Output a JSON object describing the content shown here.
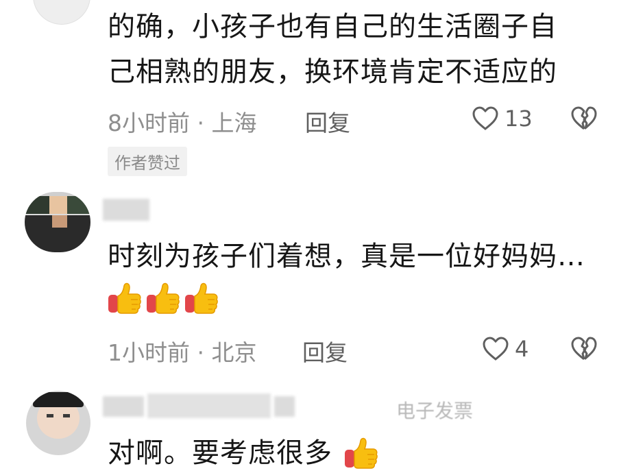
{
  "comments": [
    {
      "text_line1": "的确，小孩子也有自己的生活圈子自",
      "text_line2": "己相熟的朋友，换环境肯定不适应的",
      "meta": "8小时前 · 上海",
      "reply_label": "回复",
      "likes": "13",
      "badge": "作者赞过"
    },
    {
      "text": "时刻为孩子们着想，真是一位好妈妈…",
      "emoji": [
        "thumbs-up",
        "thumbs-up",
        "thumbs-up"
      ],
      "meta": "1小时前 · 北京",
      "reply_label": "回复",
      "likes": "4"
    },
    {
      "text": "对啊。要考虑很多",
      "emoji": [
        "thumbs-up"
      ],
      "partial_name_text": "电子发票"
    }
  ],
  "colors": {
    "text": "#161616",
    "meta": "#8e8e8e",
    "badge_bg": "#f1f1f1",
    "emoji": "#f6b300"
  }
}
